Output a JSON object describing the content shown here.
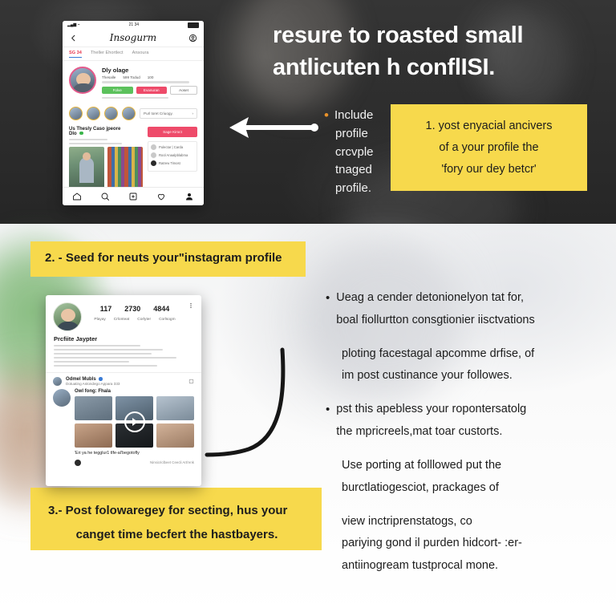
{
  "colors": {
    "accent_yellow": "#F7D94C",
    "dark_bg": "#2E2E2E",
    "light_bg": "#FAFAFA",
    "bullet_orange": "#E8922A",
    "ig_red": "#EE4B6A",
    "ig_green": "#5CC15C"
  },
  "headline": {
    "line1": "resure to roasted small",
    "line2": "antlicuten h conflISI."
  },
  "dark_bullets": {
    "bullet_marker": "•",
    "lines": [
      "Include",
      "profile",
      "crcvple",
      "tnaged",
      "profile."
    ]
  },
  "callout_1": {
    "line1": "1. yost enyacial ancivers",
    "line2": "of a your profile the",
    "line3": "'fory our dey betcr'"
  },
  "callout_2": {
    "text": "2. - Seed for neuts your\"instagram profile"
  },
  "callout_3": {
    "line1": "3.- Post folowaregey for secting, hus your",
    "line2": "canget time becfert the hastbayers."
  },
  "right_text": {
    "bullet_marker": "•",
    "block1": {
      "line1": "Ueag a cender detonionelyon tat for,",
      "line2": "boal fiollurtton consgtionier iisctvations"
    },
    "block2": {
      "line1": "ploting facestagal apcomme drfise, of",
      "line2": "im post custinance your followes."
    },
    "block3": {
      "line1": "pst this apebless your ropontersatolg",
      "line2": "the mpricreels,mat toar custorts."
    },
    "block4": {
      "line1": "Use porting at folllowed put the",
      "line2": "burctlatiogesciot, prackages of"
    },
    "block5": {
      "line1": "view inctriprenstatogs, co",
      "line2": "pariying gond il purden hidcort- :er-",
      "line3": "antiinogream tustprocal mone."
    }
  },
  "phone_1": {
    "status_time": "21 34",
    "logo": "Insogurm",
    "tabs": [
      "SG 34",
      "Theller Ehortlect",
      "Ansoura"
    ],
    "profile_name": "Dly olage",
    "stats": [
      "Thesalle",
      "599 Todud",
      "100"
    ],
    "buttons": {
      "follow": "Folve",
      "message": "Evanuran",
      "more": "Aoset"
    },
    "pill_label": "Purl toret Criuogy.",
    "feed_name": "Us Thesly Caso jpeore",
    "feed_sub": "Dlo",
    "side_button": "Sage Kiroct",
    "side_rows": [
      "Pulectar | Carda",
      "Rool Anaalpblabma",
      "Ratrew Timost"
    ],
    "nav_icons": [
      "home-icon",
      "search-icon",
      "add-post-icon",
      "heart-icon",
      "profile-icon"
    ]
  },
  "phone_2": {
    "stat_values": [
      "117",
      "2730",
      "4844"
    ],
    "stat_labels": [
      "Playay",
      "Crlonteat",
      "Corlyter",
      "Corlsogm"
    ],
    "bio_title": "Prcfiite Jaypter",
    "post_author": "Odmel Mubls",
    "post_sub": "Dotuating Astondego Appara 333",
    "post_title": "Owl fong: Fhala",
    "caption": "'Eri ya he tegglur1 tlfe-al'begotofly",
    "caption_meta": "Ninsicriclbeet Ceecli Arti'enk"
  }
}
